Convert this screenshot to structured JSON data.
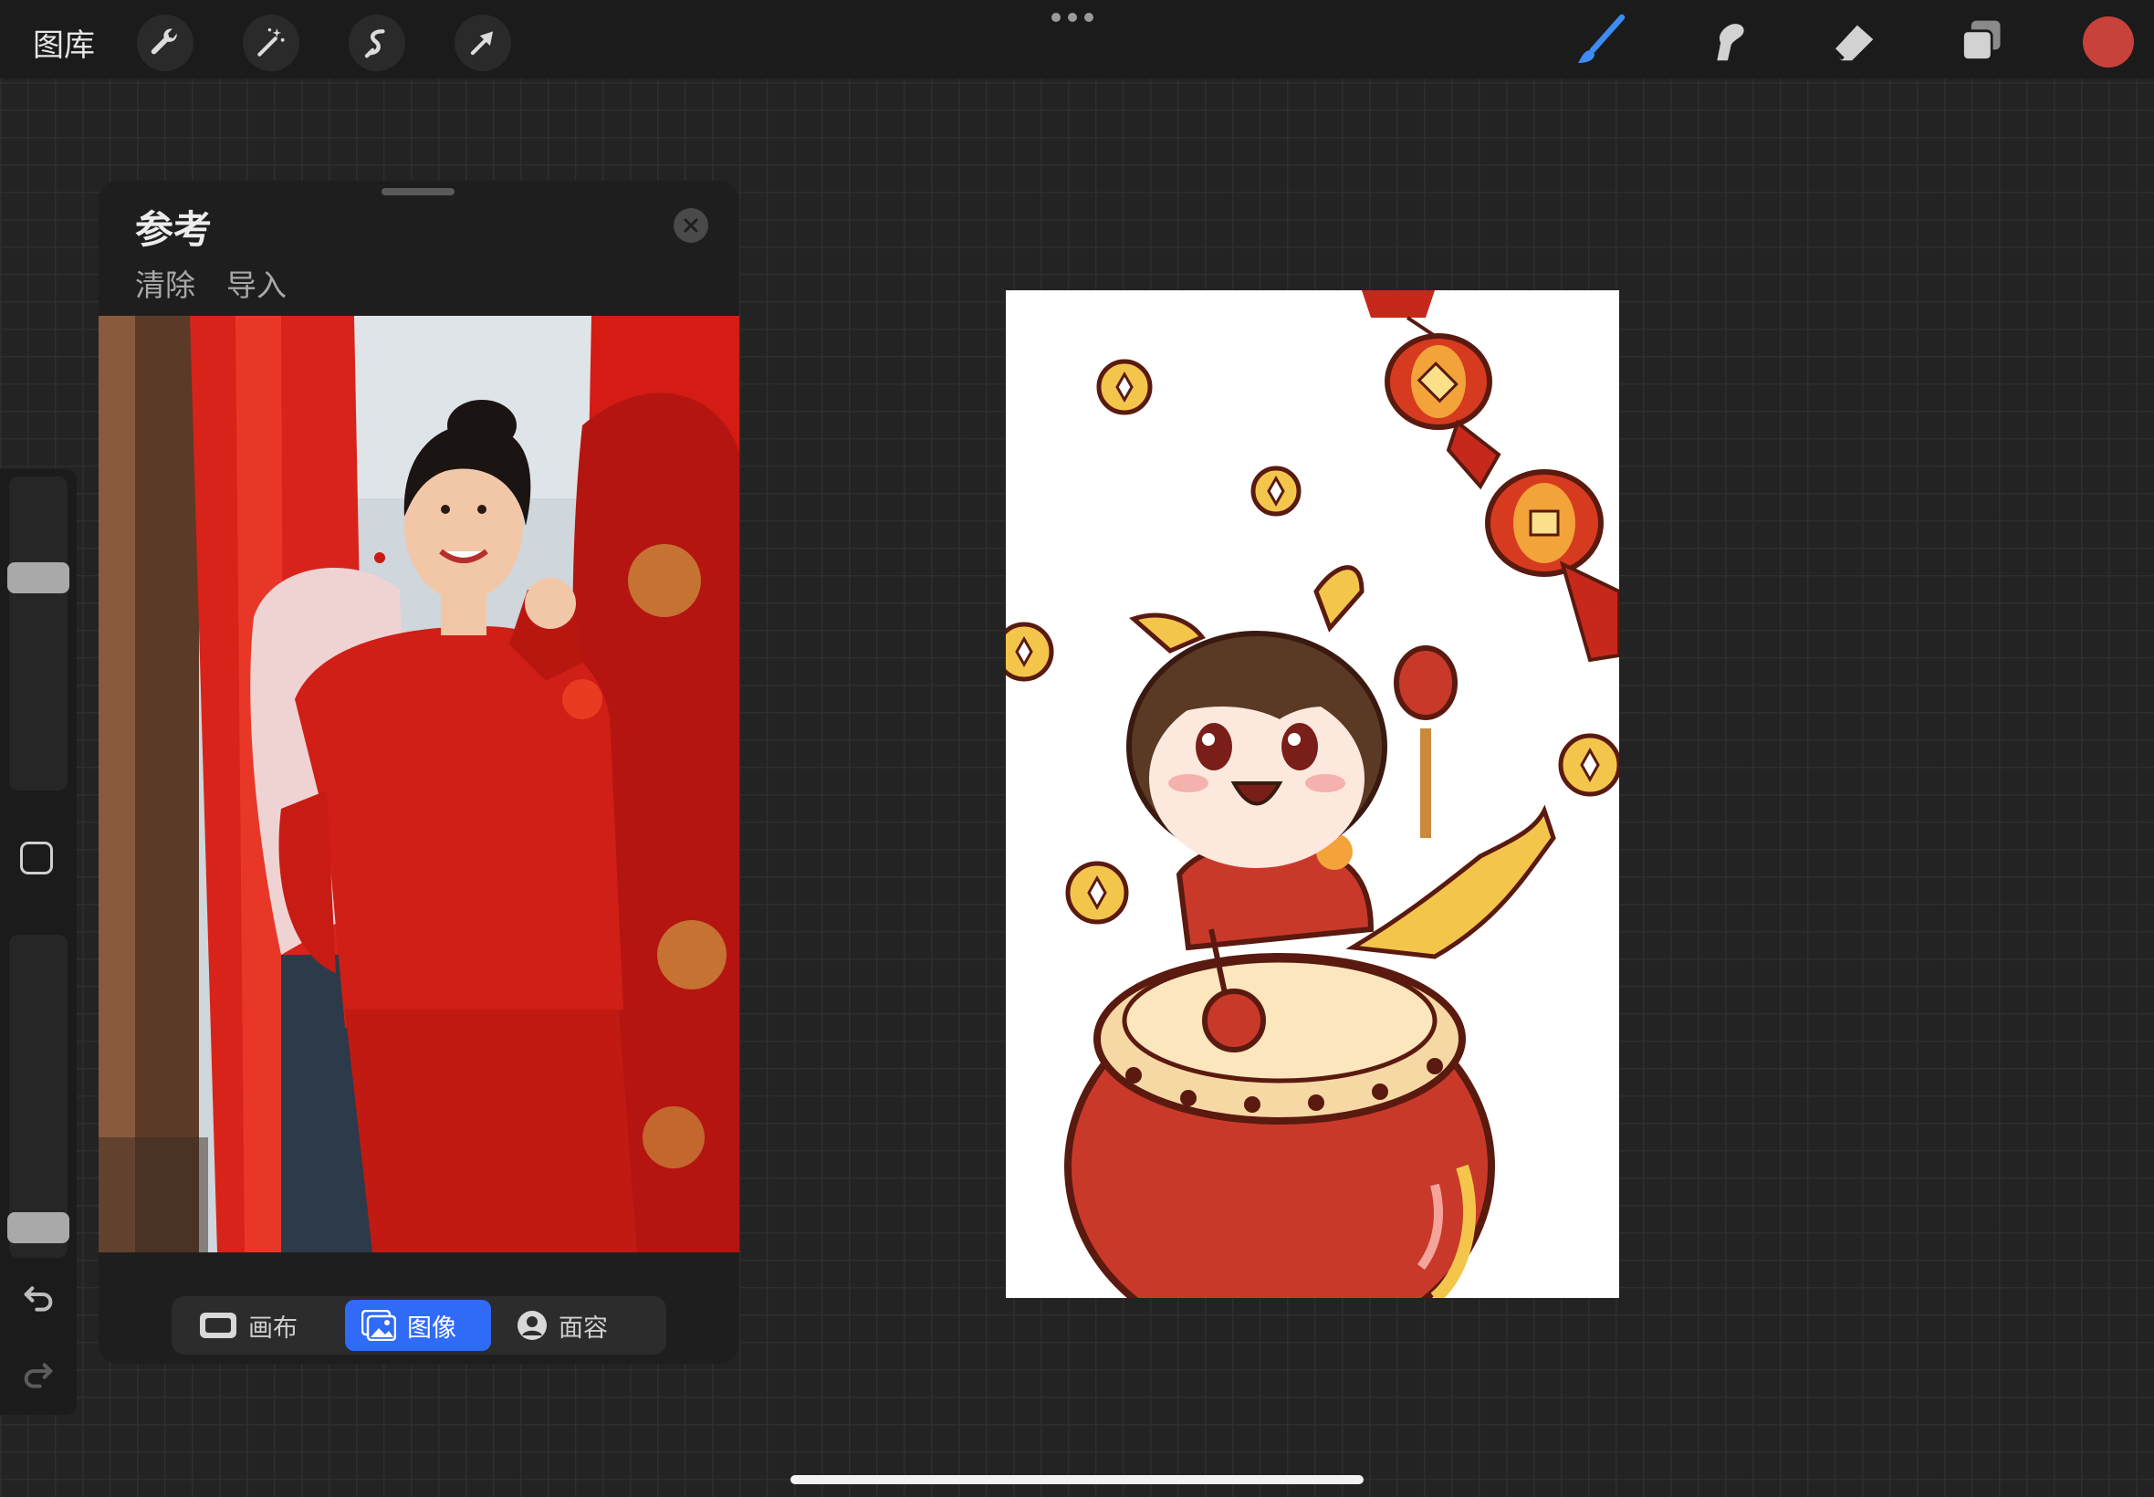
{
  "topbar": {
    "gallery_label": "图库",
    "tools": [
      "wrench-icon",
      "magic-wand-icon",
      "selection-icon",
      "transform-arrow-icon"
    ],
    "right_tools": [
      "brush-icon",
      "smudge-icon",
      "eraser-icon",
      "layers-icon"
    ],
    "active_tool": "brush",
    "current_color": "#c8413a"
  },
  "reference": {
    "title": "参考",
    "clear_label": "清除",
    "import_label": "导入",
    "tabs": [
      {
        "label": "画布",
        "icon": "canvas-icon",
        "active": false
      },
      {
        "label": "图像",
        "icon": "image-icon",
        "active": true
      },
      {
        "label": "面容",
        "icon": "face-icon",
        "active": false
      }
    ]
  },
  "colors": {
    "accent_blue": "#2f6bf6",
    "brush_blue": "#3d8cf5"
  }
}
